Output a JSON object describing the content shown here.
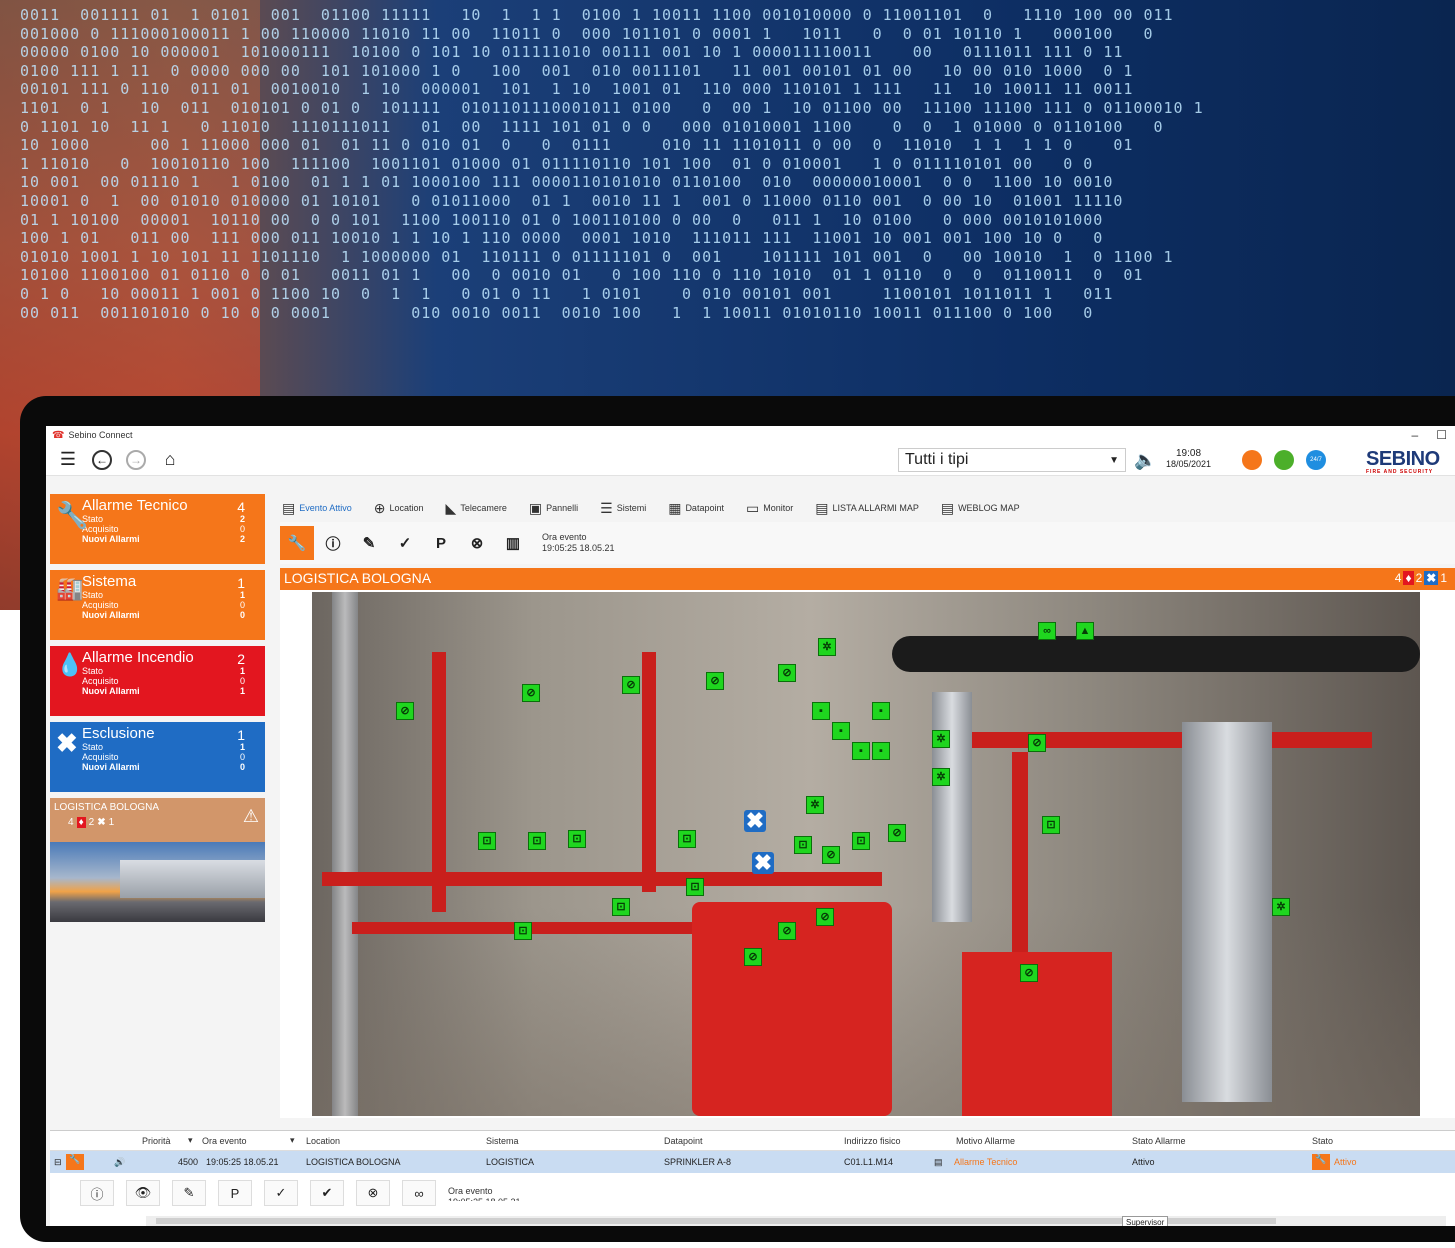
{
  "app": {
    "title": "Sebino Connect",
    "brand": "SEBINO",
    "brand_tagline": "FIRE AND SECURITY",
    "type_filter": "Tutti i tipi",
    "clock_time": "19:08",
    "clock_date": "18/05/2021",
    "badge_247": "24/7"
  },
  "background": {
    "matrix_lines": [
      "0011  001111 01  1 0101  001  01100 11111   10  1  1 1  0100 1 10011 1100 001010000 0 11001101  0   1110 100 00 011",
      "001000 0 111000100011 1 00 110000 11010 11 00  11011 0  000 101101 0 0001 1   1011   0  0 01 10110 1   000100   0",
      "00000 0100 10 000001  101000111  10100 0 101 10 011111010 00111 001 10 1 000011110011    00   0111011 111 0 11",
      "0100 111 1 11  0 0000 000 00  101 101000 1 0   100  001  010 0011101   11 001 00101 01 00   10 00 010 1000  0 1",
      "00101 111 0 110  011 01  0010010  1 10  000001  101  1 10  1001 01  110 000 110101 1 111   11  10 10011 11 0011",
      "1101  0 1   10  011  010101 0 01 0  101111  0101101110001011 0100   0  00 1  10 01100 00  11100 11100 111 0 01100010 1",
      "0 1101 10  11 1   0 11010  1110111011   01  00  1111 101 01 0 0   000 01010001 1100    0  0  1 01000 0 0110100   0",
      "10 1000      00 1 11000 000 01  01 11 0 010 01  0   0  0111     010 11 1101011 0 00  0  11010  1 1  1 1 0    01",
      "1 11010   0  10010110 100  111100  1001101 01000 01 011110110 101 100  01 0 010001   1 0 011110101 00   0 0",
      "10 001  00 01110 1   1 0100  01 1 1 01 1000100 111 0000110101010 0110100  010  00000010001  0 0  1100 10 0010",
      "10001 0  1  00 01010 010000 01 10101   0 01011000  01 1  0010 11 1  001 0 11000 0110 001  0 00 10  01001 11110",
      "01 1 10100  00001  10110 00  0 0 101  1100 100110 01 0 100110100 0 00  0   011 1  10 0100   0 000 0010101000",
      "100 1 01   011 00  111 000 011 10010 1 1 10 1 110 0000  0001 1010  111011 111  11001 10 001 001 100 10 0   0",
      "01010 1001 1 10 101 11 1101110  1 1000000 01  110111 0 01111101 0  001    101111 101 001  0   00 10010  1  0 1100 1",
      "10100 1100100 01 0110 0 0 01   0011 01 1   00  0 0010 01   0 100 110 0 110 1010  01 1 0110  0  0  0110011  0  01",
      "0 1 0   10 00011 1 001 0 1100 10  0  1  1   0 01 0 11   1 0101    0 010 00101 001     1100101 1011011 1   011",
      "00 011  001101010 0 10 0 0 0001        010 0010 0011  0010 100   1  1 10011 01010110 10011 011100 0 100   0"
    ]
  },
  "sidebar": {
    "cards": [
      {
        "title": "Allarme Tecnico",
        "count": "4",
        "rows": [
          {
            "label": "Stato",
            "value": "2"
          },
          {
            "label": "Acquisito",
            "value": "0"
          },
          {
            "label": "Nuovi Allarmi",
            "value": "2"
          }
        ]
      },
      {
        "title": "Sistema",
        "count": "1",
        "rows": [
          {
            "label": "Stato",
            "value": "1"
          },
          {
            "label": "Acquisito",
            "value": "0"
          },
          {
            "label": "Nuovi Allarmi",
            "value": "0"
          }
        ]
      },
      {
        "title": "Allarme Incendio",
        "count": "2",
        "rows": [
          {
            "label": "Stato",
            "value": "1"
          },
          {
            "label": "Acquisito",
            "value": "0"
          },
          {
            "label": "Nuovi Allarmi",
            "value": "1"
          }
        ]
      },
      {
        "title": "Esclusione",
        "count": "1",
        "rows": [
          {
            "label": "Stato",
            "value": "1"
          },
          {
            "label": "Acquisito",
            "value": "0"
          },
          {
            "label": "Nuovi Allarmi",
            "value": "0"
          }
        ]
      }
    ],
    "location": {
      "name": "LOGISTICA BOLOGNA",
      "tech": "4",
      "fire": "2",
      "excl": "1"
    }
  },
  "tabs": [
    {
      "label": "Evento Attivo"
    },
    {
      "label": "Location"
    },
    {
      "label": "Telecamere"
    },
    {
      "label": "Pannelli"
    },
    {
      "label": "Sistemi"
    },
    {
      "label": "Datapoint"
    },
    {
      "label": "Monitor"
    },
    {
      "label": "LISTA ALLARMI MAP"
    },
    {
      "label": "WEBLOG MAP"
    }
  ],
  "actionbar": {
    "event_label": "Ora evento",
    "event_time": "19:05:25 18.05.21",
    "buttons": [
      "wrench",
      "info",
      "pen",
      "check",
      "P",
      "stop",
      "log"
    ]
  },
  "map": {
    "title": "LOGISTICA BOLOGNA",
    "tech": "4",
    "fire": "2",
    "excl": "1"
  },
  "grid": {
    "columns": [
      "Priorità",
      "Ora evento",
      "Location",
      "Sistema",
      "Datapoint",
      "Indirizzo fisico",
      "Motivo Allarme",
      "Stato Allarme",
      "Stato"
    ],
    "row": {
      "priority": "4500",
      "time": "19:05:25 18.05.21",
      "location": "LOGISTICA BOLOGNA",
      "system": "LOGISTICA",
      "datapoint": "SPRINKLER A-8",
      "address": "C01.L1.M14",
      "reason": "Allarme Tecnico",
      "alarm_state": "Attivo",
      "state": "Attivo"
    },
    "sub_event_label": "Ora evento",
    "sub_event_time": "19:05:25 18.05.21",
    "tooltip": "Supervisor"
  },
  "colors": {
    "orange": "#f5761a",
    "red": "#e3161f",
    "blue": "#1f6cc4",
    "marker_green": "#1fd61f"
  }
}
